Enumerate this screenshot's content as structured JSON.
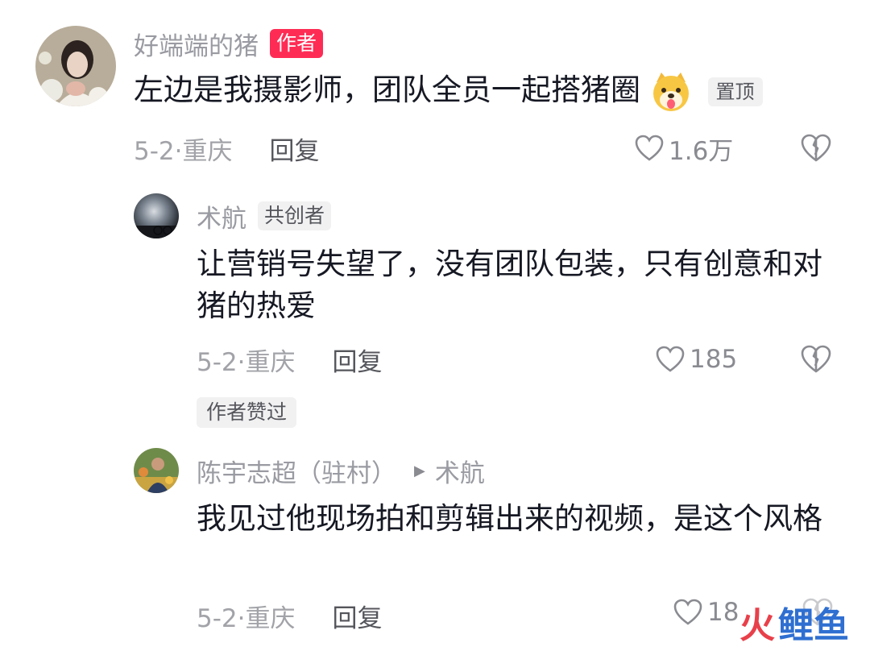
{
  "comments": [
    {
      "username": "好端端的猪",
      "badge": "作者",
      "text": "左边是我摄影师，团队全员一起搭猪圈",
      "pinned": "置顶",
      "date": "5-2·重庆",
      "reply": "回复",
      "likes": "1.6万"
    },
    {
      "username": "术航",
      "badge": "共创者",
      "text": "让营销号失望了，没有团队包装，只有创意和对猪的热爱",
      "date": "5-2·重庆",
      "reply": "回复",
      "likes": "185",
      "tag": "作者赞过"
    },
    {
      "username": "陈宇志超（驻村）",
      "reply_to": "术航",
      "text": "我见过他现场拍和剪辑出来的视频，是这个风格",
      "date": "5-2·重庆",
      "reply": "回复",
      "likes": "18"
    }
  ],
  "watermark": {
    "glyph": "火",
    "text": "鲤鱼"
  },
  "colors": {
    "accent": "#fe2c55",
    "muted": "#9a9ba2",
    "text": "#161823"
  }
}
